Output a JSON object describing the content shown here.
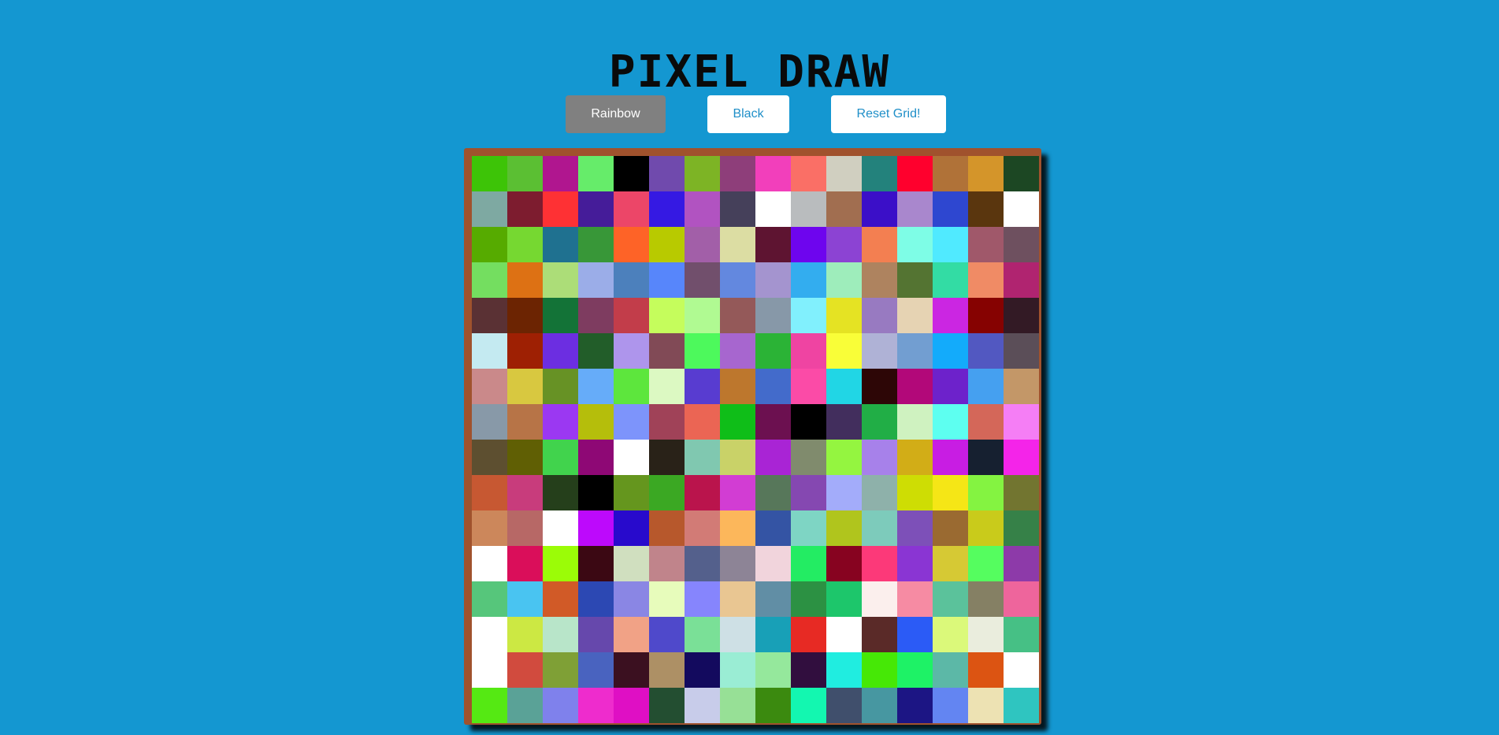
{
  "title": "PIXEL DRAW",
  "toolbar": {
    "rainbow_label": "Rainbow",
    "black_label": "Black",
    "reset_label": "Reset Grid!",
    "active_mode": "rainbow"
  },
  "colors": {
    "background": "#1497d1",
    "board_border": "#a0522d",
    "active_button": "#808080",
    "button": "#ffffff",
    "button_text": "#1f8fc8"
  },
  "grid": {
    "columns": 16,
    "rows_visible": 16,
    "cells": [
      [
        "#3dc407",
        "#5bbf33",
        "#b0168f",
        "#66ec6a",
        "#000000",
        "#704aad",
        "#7db425",
        "#8e3e7a",
        "#f23fbb",
        "#fa6f66",
        "#d0cfc0",
        "#23827c",
        "#ff002d",
        "#b07238",
        "#d4952a",
        "#1c4723"
      ],
      [
        "#7ea9a2",
        "#7d1c2f",
        "#fe3134",
        "#451c99",
        "#ec4668",
        "#3519e3",
        "#b153c1",
        "#45405a",
        "#ffffff",
        "#b9bcbe",
        "#a16e50",
        "#3b0fc8",
        "#a987cd",
        "#2e47d0",
        "#5a360e",
        "#ffffff"
      ],
      [
        "#56ab00",
        "#76d831",
        "#1f7190",
        "#389738",
        "#fe6327",
        "#b8ca00",
        "#a25fa8",
        "#dcdda3",
        "#5e1431",
        "#6e05ee",
        "#8c43d3",
        "#f37f51",
        "#7efde6",
        "#50eaff",
        "#a0586a",
        "#6e505f"
      ],
      [
        "#74de60",
        "#dd7114",
        "#acdd78",
        "#9bade8",
        "#4c80bc",
        "#5786fb",
        "#714f6c",
        "#6388df",
        "#a494cf",
        "#33adef",
        "#9eedbb",
        "#ae835f",
        "#547432",
        "#33dca4",
        "#f08b65",
        "#b02470"
      ],
      [
        "#5a3134",
        "#6c2402",
        "#137337",
        "#7e3c60",
        "#c23d4a",
        "#c5fd5c",
        "#b0fa92",
        "#945959",
        "#8798a8",
        "#81f0fd",
        "#e5e323",
        "#987ac1",
        "#e6d3b3",
        "#cb26e2",
        "#860201",
        "#331a25"
      ],
      [
        "#c4eaf1",
        "#9e2003",
        "#6c2ee1",
        "#225d29",
        "#ae95ec",
        "#814a56",
        "#4df95c",
        "#a766cf",
        "#2bb336",
        "#ef44a2",
        "#f9fe38",
        "#afb2d6",
        "#729ed1",
        "#13abfb",
        "#5258c1",
        "#5b4e58"
      ],
      [
        "#ca898a",
        "#d8c840",
        "#679225",
        "#66acf9",
        "#5de63d",
        "#dcf9c2",
        "#583cd0",
        "#bd772d",
        "#436bcb",
        "#fb4ba7",
        "#21d6e5",
        "#2d0606",
        "#b20879",
        "#6d22cb",
        "#45a0f0",
        "#c39768"
      ],
      [
        "#8899a8",
        "#b77447",
        "#9b38f2",
        "#b5be0b",
        "#7d94fb",
        "#a04258",
        "#eb6554",
        "#0fbe18",
        "#6c1050",
        "#000000",
        "#422e5d",
        "#21ae46",
        "#cff2c0",
        "#5dfff0",
        "#d46759",
        "#f57ef5"
      ],
      [
        "#5d4f30",
        "#605f04",
        "#41d34d",
        "#8e0875",
        "#ffffff",
        "#292218",
        "#80c8b0",
        "#c9d268",
        "#a924d5",
        "#808b6d",
        "#94f540",
        "#a781ea",
        "#d2ad17",
        "#c81de3",
        "#162030",
        "#f424e9"
      ],
      [
        "#c75832",
        "#c83c7c",
        "#253f1b",
        "#000000",
        "#65961e",
        "#3ba823",
        "#ba144c",
        "#d23dd3",
        "#57775a",
        "#8548b1",
        "#a3acfa",
        "#8eb1aa",
        "#cedd04",
        "#f5e616",
        "#84f341",
        "#727530"
      ],
      [
        "#cc875b",
        "#b76866",
        "#ffffff",
        "#bd09fc",
        "#280acc",
        "#b7582c",
        "#d27b76",
        "#fcb75b",
        "#3454a4",
        "#7ed5c4",
        "#b0c51d",
        "#7dcbbb",
        "#7d50b8",
        "#9a6a31",
        "#c9cb1b",
        "#368148"
      ],
      [
        "#ffffff",
        "#da0e5a",
        "#9bfc07",
        "#3b0813",
        "#d0dfbf",
        "#c0848b",
        "#54608c",
        "#8d8496",
        "#f1d4dc",
        "#23ec63",
        "#870320",
        "#fc3979",
        "#8a35d3",
        "#d6c934",
        "#55fd5f",
        "#8d3aa9"
      ],
      [
        "#56c67b",
        "#49c4f1",
        "#d15a27",
        "#2c48b3",
        "#8a86e4",
        "#e7fcbb",
        "#8685fd",
        "#e9c692",
        "#618ea5",
        "#2c9143",
        "#1dc66b",
        "#fbefed",
        "#f68ba3",
        "#5bc29b",
        "#858064",
        "#ee659c"
      ],
      [
        "#ffffff",
        "#cce843",
        "#b8e5c9",
        "#6648ac",
        "#f1a286",
        "#4f49cb",
        "#7ae097",
        "#cee0e5",
        "#18a0b7",
        "#e72a24",
        "#ffffff",
        "#5a2a28",
        "#2b5bf6",
        "#dbf97a",
        "#eaeddd",
        "#46c085"
      ],
      [
        "#ffffff",
        "#d14b3e",
        "#7fa036",
        "#4963bf",
        "#3b1020",
        "#ad9065",
        "#130a5e",
        "#9aedd4",
        "#95e89c",
        "#310e3e",
        "#20ede0",
        "#46e806",
        "#1ef266",
        "#5cb8a7",
        "#dc5412",
        "#ffffff"
      ],
      [
        "#55e913",
        "#5aa297",
        "#7f81ec",
        "#ee2ccd",
        "#df0fc4",
        "#234e31",
        "#c8ccea",
        "#97e096",
        "#3b8a0f",
        "#13f7b0",
        "#404f6c",
        "#4797a1",
        "#1c1584",
        "#6385f2",
        "#ede2b3",
        "#2fc5c0"
      ]
    ]
  }
}
